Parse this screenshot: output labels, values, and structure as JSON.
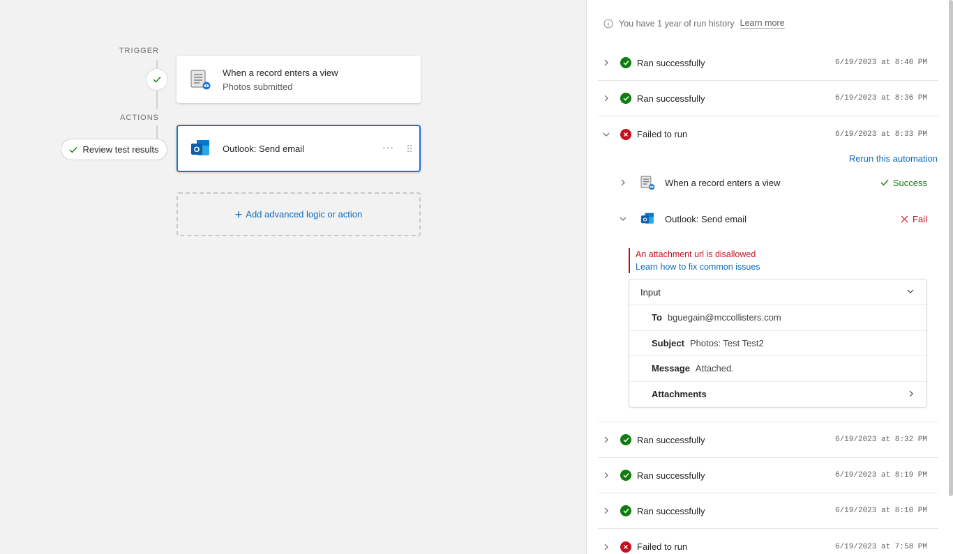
{
  "canvas": {
    "trigger_label": "TRIGGER",
    "actions_label": "ACTIONS",
    "review_button": "Review test results",
    "trigger_card": {
      "title": "When a record enters a view",
      "subtitle": "Photos submitted",
      "icon": "table-view-icon"
    },
    "action_card": {
      "title": "Outlook: Send email",
      "icon": "outlook-icon",
      "more": "···"
    },
    "add_action": "Add advanced logic or action"
  },
  "panel": {
    "info_text": "You have 1 year of run history",
    "info_link": "Learn more",
    "runs": [
      {
        "status": "ok",
        "label": "Ran successfully",
        "timestamp": "6/19/2023 at 8:40 PM",
        "expanded": false
      },
      {
        "status": "ok",
        "label": "Ran successfully",
        "timestamp": "6/19/2023 at 8:36 PM",
        "expanded": false
      },
      {
        "status": "fail",
        "label": "Failed to run",
        "timestamp": "6/19/2023 at 8:33 PM",
        "expanded": true
      },
      {
        "status": "ok",
        "label": "Ran successfully",
        "timestamp": "6/19/2023 at 8:32 PM",
        "expanded": false
      },
      {
        "status": "ok",
        "label": "Ran successfully",
        "timestamp": "6/19/2023 at 8:19 PM",
        "expanded": false
      },
      {
        "status": "ok",
        "label": "Ran successfully",
        "timestamp": "6/19/2023 at 8:10 PM",
        "expanded": false
      },
      {
        "status": "fail",
        "label": "Failed to run",
        "timestamp": "6/19/2023 at 7:58 PM",
        "expanded": false
      }
    ],
    "rerun": "Rerun this automation",
    "steps": [
      {
        "label": "When a record enters a view",
        "result": "Success",
        "icon": "table-view-icon"
      },
      {
        "label": "Outlook: Send email",
        "result": "Fail",
        "icon": "outlook-icon"
      }
    ],
    "error": {
      "message": "An attachment url is disallowed",
      "fix_link": "Learn how to fix common issues"
    },
    "input": {
      "title": "Input",
      "fields": [
        {
          "key": "To",
          "value": "bguegain@mccollisters.com"
        },
        {
          "key": "Subject",
          "value": "Photos: Test Test2"
        },
        {
          "key": "Message",
          "value": "Attached."
        },
        {
          "key": "Attachments",
          "value": ""
        }
      ]
    }
  },
  "colors": {
    "accent": "#0f6cbd",
    "success": "#107c10",
    "danger": "#c50f1f",
    "selected_border": "#1a73d9"
  }
}
